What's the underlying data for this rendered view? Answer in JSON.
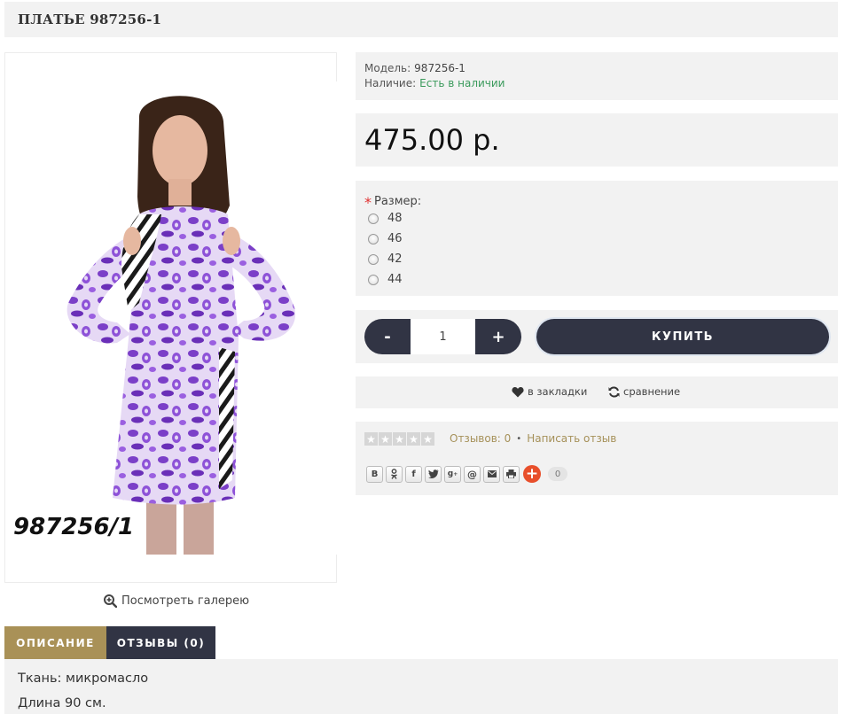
{
  "product": {
    "title": "ПЛАТЬЕ 987256-1",
    "photo_code": "987256/1",
    "gallery_link": "Посмотреть галерею",
    "model_label": "Модель:",
    "model_value": "987256-1",
    "availability_label": "Наличие:",
    "availability_value": "Есть в наличии",
    "price": "475.00 р."
  },
  "options": {
    "required_mark": "*",
    "size_label": "Размер:",
    "sizes": [
      "48",
      "46",
      "42",
      "44"
    ]
  },
  "cart": {
    "minus_label": "-",
    "plus_label": "+",
    "quantity": "1",
    "buy_label": "КУПИТЬ"
  },
  "actions": {
    "wishlist_label": "в закладки",
    "compare_label": "сравнение"
  },
  "reviews": {
    "rating": 0,
    "max_rating": 5,
    "count_label": "Отзывов: 0",
    "separator": "•",
    "write_label": "Написать отзыв"
  },
  "share": {
    "buttons": [
      "vk-icon",
      "odnoklassniki-icon",
      "facebook-icon",
      "twitter-icon",
      "google-plus-icon",
      "mail-ru-icon",
      "email-icon",
      "print-icon"
    ],
    "count": "0",
    "plus_color": "#e84f2b"
  },
  "tabs": [
    {
      "label": "ОПИСАНИЕ",
      "active": true
    },
    {
      "label": "ОТЗЫВЫ (0)",
      "active": false
    }
  ],
  "description": {
    "lines": [
      "Ткань: микромасло",
      "Длина 90 см."
    ]
  },
  "colors": {
    "dark": "#313444",
    "gold": "#a99157",
    "green": "#3a9a5b",
    "panel": "#f2f2f2",
    "review_link": "#a6915a"
  }
}
